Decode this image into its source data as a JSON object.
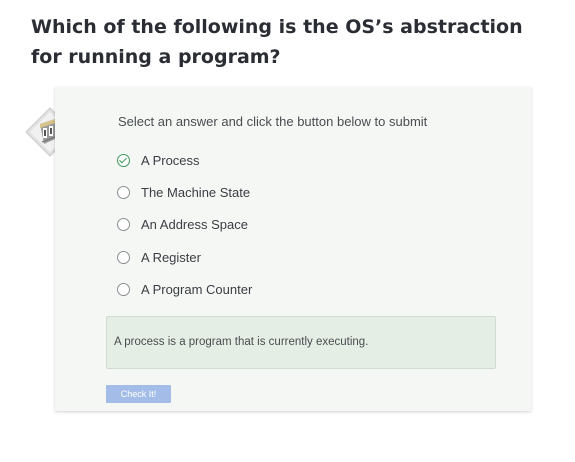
{
  "question": {
    "text": "Which of the following is the OS’s abstraction for running a program?"
  },
  "quiz": {
    "instruction": "Select an answer and click the button below to submit",
    "options": [
      {
        "label": "A Process",
        "selected": true
      },
      {
        "label": "The Machine State",
        "selected": false
      },
      {
        "label": "An Address Space",
        "selected": false
      },
      {
        "label": "A Register",
        "selected": false
      },
      {
        "label": "A Program Counter",
        "selected": false
      }
    ],
    "feedback": "A process is a program that is currently executing.",
    "submit_label": "Check It!"
  },
  "colors": {
    "card_background": "#f4f7f4",
    "feedback_background": "#e5eee4",
    "selected_check": "#3d9a5b",
    "button_background": "#a4bde8"
  },
  "icons": {
    "quiz_icon": "machine-diamond-icon"
  }
}
